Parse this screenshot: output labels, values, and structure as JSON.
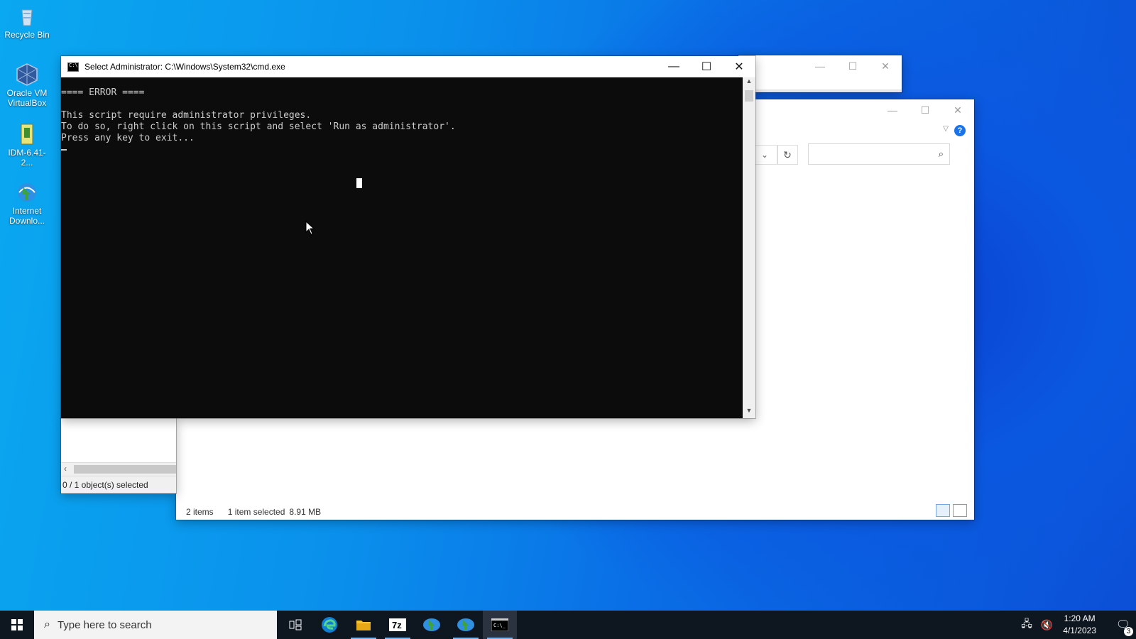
{
  "desktop": {
    "icons": [
      {
        "label": "Recycle Bin",
        "icon": "recycle-bin-icon"
      },
      {
        "label": "Oracle VM VirtualBox",
        "icon": "virtualbox-icon"
      },
      {
        "label": "IDM-6.41-2...",
        "icon": "installer-icon"
      },
      {
        "label": "Internet Downlo...",
        "icon": "internet-download-manager-icon"
      }
    ]
  },
  "cmd": {
    "title": "Select Administrator: C:\\Windows\\System32\\cmd.exe",
    "lines": [
      "==== ERROR ====",
      "",
      "This script require administrator privileges.",
      "To do so, right click on this script and select 'Run as administrator'.",
      "Press any key to exit..."
    ],
    "caption": {
      "minimize": "—",
      "maximize": "☐",
      "close": "✕"
    }
  },
  "explorer": {
    "status_items": "2 items",
    "status_selected": "1 item selected",
    "status_size": "8.91 MB"
  },
  "left_window": {
    "status": "0 / 1 object(s) selected"
  },
  "taskbar": {
    "search_placeholder": "Type here to search",
    "apps": [
      "task-view-icon",
      "edge-icon",
      "file-explorer-icon",
      "7zip-icon",
      "idm-icon",
      "idm-icon-2",
      "cmd-icon"
    ],
    "time": "1:20 AM",
    "date": "4/1/2023",
    "notification_count": "3"
  }
}
